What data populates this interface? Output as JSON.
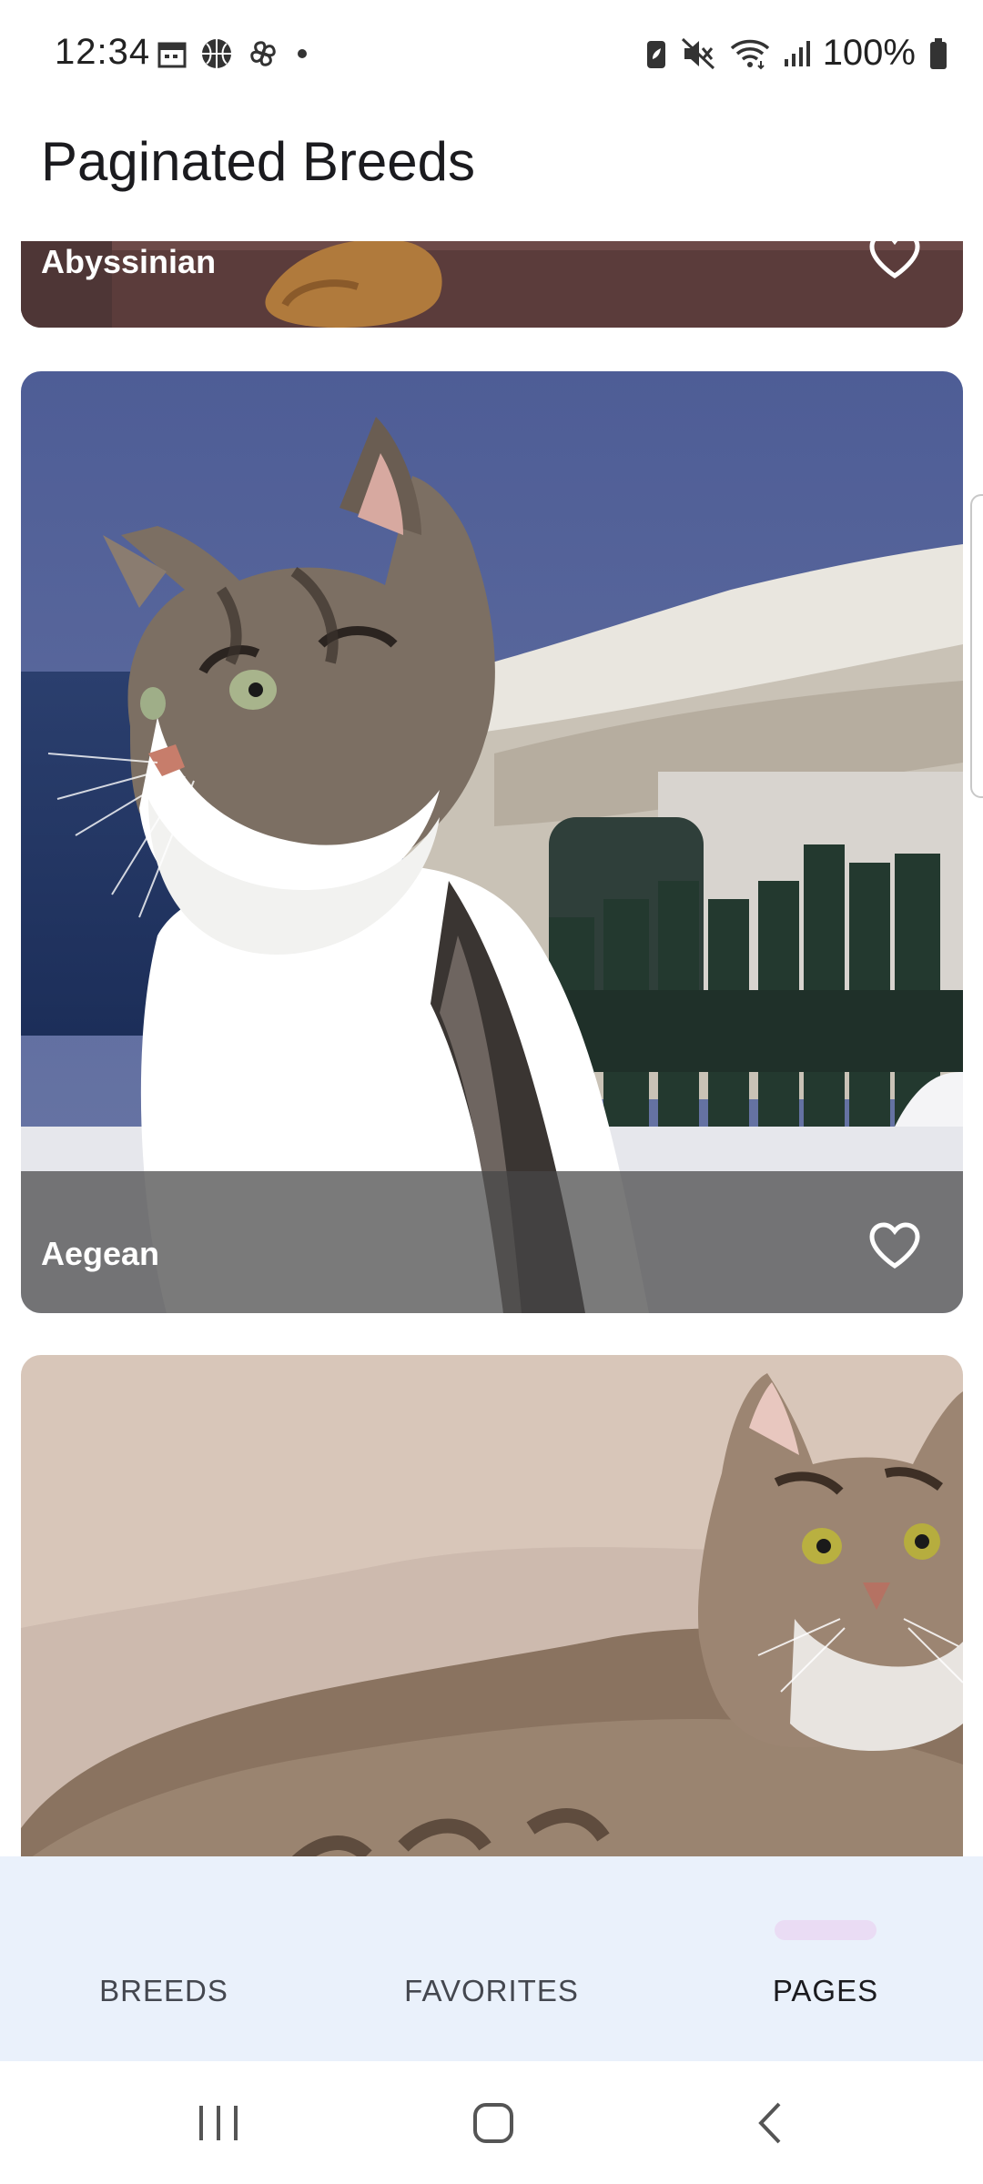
{
  "status_bar": {
    "time": "12:34",
    "left_icons": [
      "calendar-icon",
      "basketball-icon",
      "pinwheel-icon",
      "dot-icon"
    ],
    "right_icons": [
      "battery-saver-icon",
      "mute-icon",
      "wifi-icon",
      "signal-icon"
    ],
    "battery": "100%"
  },
  "app_bar": {
    "title": "Paginated Breeds"
  },
  "breeds": [
    {
      "name": "Abyssinian",
      "favorite_icon": "heart-outline-icon"
    },
    {
      "name": "Aegean",
      "favorite_icon": "heart-outline-icon"
    },
    {
      "name": "",
      "favorite_icon": ""
    }
  ],
  "bottom_nav": {
    "items": [
      {
        "label": "BREEDS"
      },
      {
        "label": "FAVORITES"
      },
      {
        "label": "PAGES"
      }
    ],
    "active": "PAGES"
  },
  "system_nav": {
    "buttons": [
      "recent-apps-icon",
      "home-icon",
      "back-icon"
    ]
  },
  "colors": {
    "nav_background": "#eaf1fb",
    "active_indicator": "#eadcf4",
    "scrim": "#464646"
  }
}
